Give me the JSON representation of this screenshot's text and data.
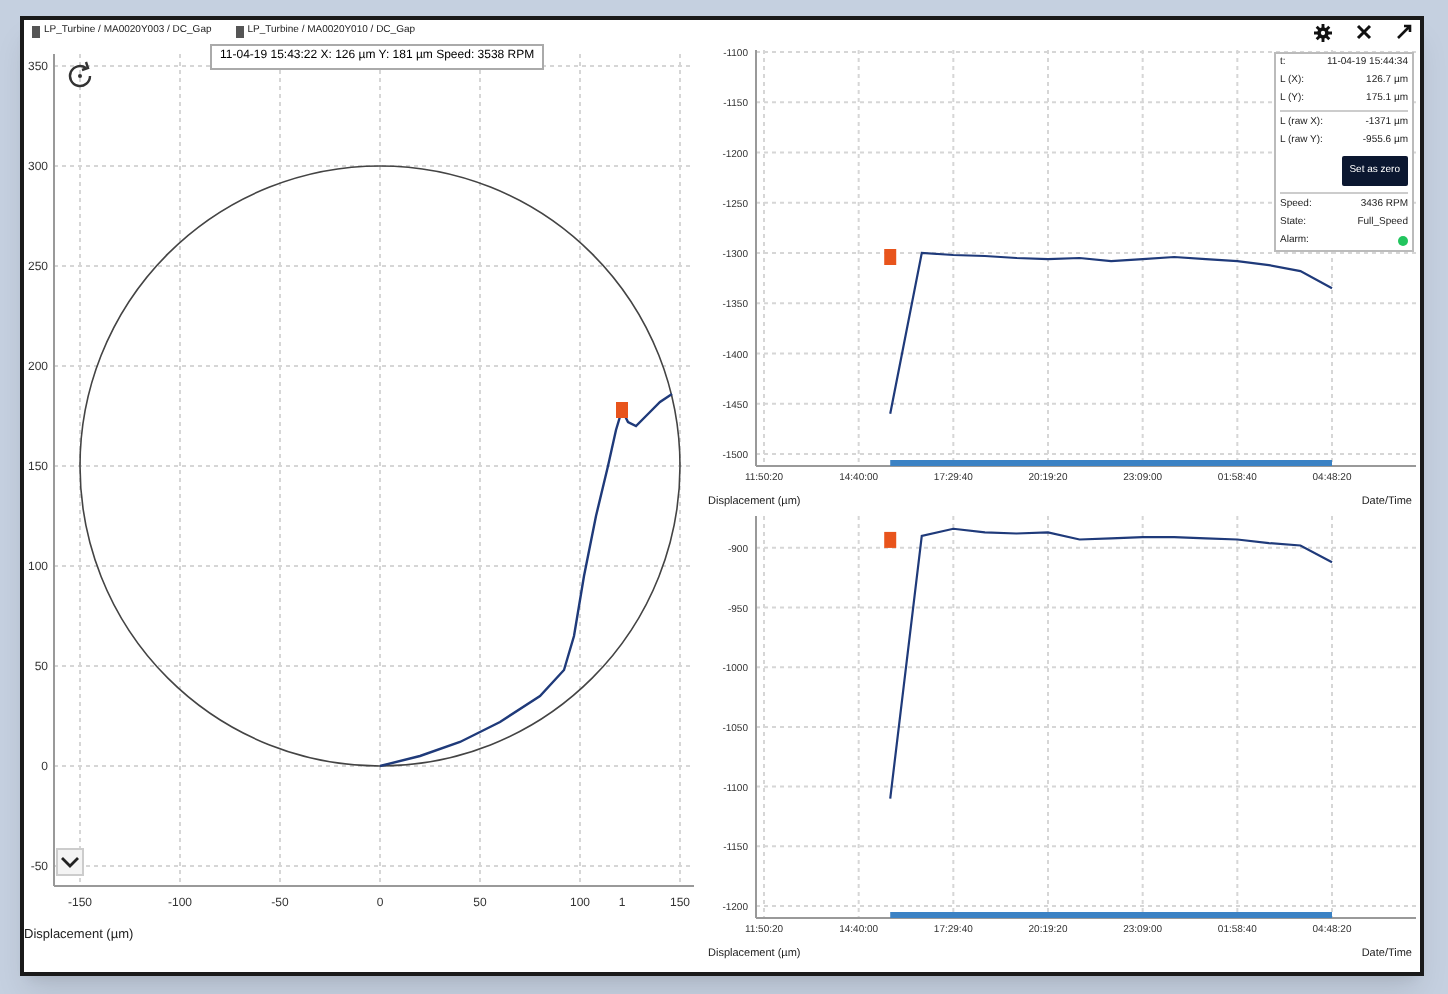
{
  "header": {
    "channels": [
      "LP_Turbine / MA0020Y003 / DC_Gap",
      "LP_Turbine / MA0020Y010 / DC_Gap"
    ]
  },
  "orbit": {
    "tooltip": "11-04-19 15:43:22  X: 126 µm  Y: 181 µm  Speed: 3538 RPM",
    "marker_label": "1",
    "chart_data": {
      "type": "line",
      "xlabel": "Displacement (µm)",
      "xlim": [
        -150,
        150
      ],
      "ylim": [
        -50,
        350
      ],
      "grid": true,
      "xticks": [
        -150,
        -100,
        -50,
        0,
        50,
        100,
        150
      ],
      "yticks": [
        -50,
        0,
        50,
        100,
        150,
        200,
        250,
        300,
        350
      ],
      "series": [
        {
          "color": "#1f3a7a",
          "x": [
            0,
            20,
            40,
            60,
            80,
            92,
            97,
            102,
            108,
            114,
            118,
            121,
            124,
            128,
            134,
            140,
            146
          ],
          "values": [
            0,
            5,
            12,
            22,
            35,
            48,
            65,
            95,
            125,
            150,
            168,
            178,
            172,
            170,
            176,
            182,
            186
          ]
        }
      ]
    }
  },
  "trend_x": {
    "chart_data": {
      "type": "line",
      "xlabel": "Date/Time",
      "ylabel": "Displacement (µm)",
      "ylim": [
        -1500,
        -1100
      ],
      "grid": true,
      "categories": [
        "11:50:20",
        null,
        null,
        "14:40:00",
        null,
        null,
        "17:29:40",
        null,
        null,
        "20:19:20",
        null,
        null,
        "23:09:00",
        null,
        null,
        "01:58:40",
        null,
        null,
        "04:48:20"
      ],
      "yticks": [
        -1100,
        -1150,
        -1200,
        -1250,
        -1300,
        -1350,
        -1400,
        -1450,
        -1500
      ],
      "series": [
        {
          "color": "#1f3a7a",
          "values": [
            null,
            null,
            null,
            null,
            -1460,
            -1300,
            -1302,
            -1303,
            -1305,
            -1306,
            -1305,
            -1308,
            -1306,
            -1304,
            -1306,
            -1308,
            -1312,
            -1318,
            -1335
          ]
        }
      ]
    }
  },
  "trend_y": {
    "chart_data": {
      "type": "line",
      "xlabel": "Date/Time",
      "ylabel": "Displacement (µm)",
      "ylim": [
        -1200,
        -875
      ],
      "grid": true,
      "categories": [
        "11:50:20",
        null,
        null,
        "14:40:00",
        null,
        null,
        "17:29:40",
        null,
        null,
        "20:19:20",
        null,
        null,
        "23:09:00",
        null,
        null,
        "01:58:40",
        null,
        null,
        "04:48:20"
      ],
      "yticks": [
        -900,
        -950,
        -1000,
        -1050,
        -1100,
        -1150,
        -1200
      ],
      "series": [
        {
          "color": "#1f3a7a",
          "values": [
            null,
            null,
            null,
            null,
            -1110,
            -890,
            -884,
            -887,
            -888,
            -887,
            -893,
            -892,
            -891,
            -891,
            -892,
            -893,
            -896,
            -898,
            -912
          ]
        }
      ]
    }
  },
  "info": {
    "rows": [
      {
        "label": "t:",
        "value": "11-04-19 15:44:34"
      },
      {
        "label": "L (X):",
        "value": "126.7 µm"
      },
      {
        "label": "L (Y):",
        "value": "175.1 µm"
      }
    ],
    "raw_rows": [
      {
        "label": "L (raw X):",
        "value": "-1371 µm"
      },
      {
        "label": "L (raw Y):",
        "value": "-955.6 µm"
      }
    ],
    "button": "Set as zero",
    "status_rows": [
      {
        "label": "Speed:",
        "value": "3436 RPM"
      },
      {
        "label": "State:",
        "value": "Full_Speed"
      }
    ],
    "alarm": {
      "label": "Alarm:",
      "color": "#22c55e"
    }
  }
}
